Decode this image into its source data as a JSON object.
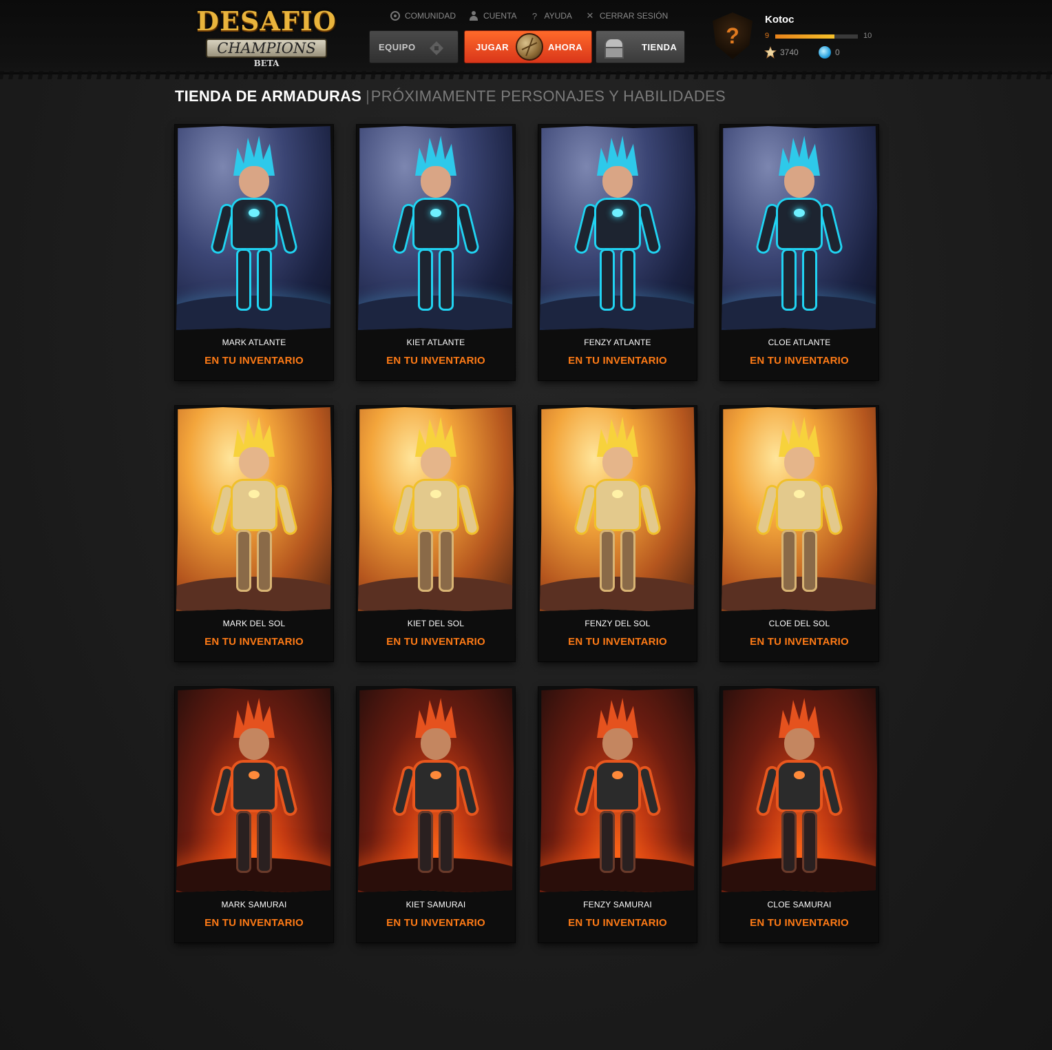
{
  "logo": {
    "title": "DESAFIO",
    "banner": "CHAMPIONS",
    "tag": "BETA"
  },
  "topnav": [
    {
      "label": "COMUNIDAD",
      "icon": "community-icon"
    },
    {
      "label": "CUENTA",
      "icon": "account-icon"
    },
    {
      "label": "AYUDA",
      "icon": "help-icon"
    },
    {
      "label": "CERRAR SESIÓN",
      "icon": "close-icon"
    }
  ],
  "buttons": {
    "equipo": "EQUIPO",
    "jugar": "JUGAR",
    "ahora": "AHORA",
    "tienda": "TIENDA"
  },
  "profile": {
    "username": "Kotoc",
    "level_current": "9",
    "level_next": "10",
    "level_progress": 0.72,
    "currency_1": "3740",
    "currency_2": "0"
  },
  "page": {
    "title": "TIENDA DE ARMADURAS",
    "separator": "|",
    "subtitle": "PRÓXIMAMENTE PERSONAJES Y HABILIDADES"
  },
  "items": [
    {
      "name": "MARK ATLANTE",
      "status": "EN TU INVENTARIO"
    },
    {
      "name": "KIET ATLANTE",
      "status": "EN TU INVENTARIO"
    },
    {
      "name": "FENZY ATLANTE",
      "status": "EN TU INVENTARIO"
    },
    {
      "name": "CLOE ATLANTE",
      "status": "EN TU INVENTARIO"
    },
    {
      "name": "MARK DEL SOL",
      "status": "EN TU INVENTARIO"
    },
    {
      "name": "KIET DEL SOL",
      "status": "EN TU INVENTARIO"
    },
    {
      "name": "FENZY DEL SOL",
      "status": "EN TU INVENTARIO"
    },
    {
      "name": "CLOE DEL SOL",
      "status": "EN TU INVENTARIO"
    },
    {
      "name": "MARK SAMURAI",
      "status": "EN TU INVENTARIO"
    },
    {
      "name": "KIET SAMURAI",
      "status": "EN TU INVENTARIO"
    },
    {
      "name": "FENZY SAMURAI",
      "status": "EN TU INVENTARIO"
    },
    {
      "name": "CLOE SAMURAI",
      "status": "EN TU INVENTARIO"
    }
  ],
  "colors": {
    "accent_orange": "#ff7b16",
    "play_button": "#e84a22",
    "atlante_glow": "#21d3f2",
    "sol_gold": "#f1c02a",
    "samurai_red": "#e9561d"
  }
}
